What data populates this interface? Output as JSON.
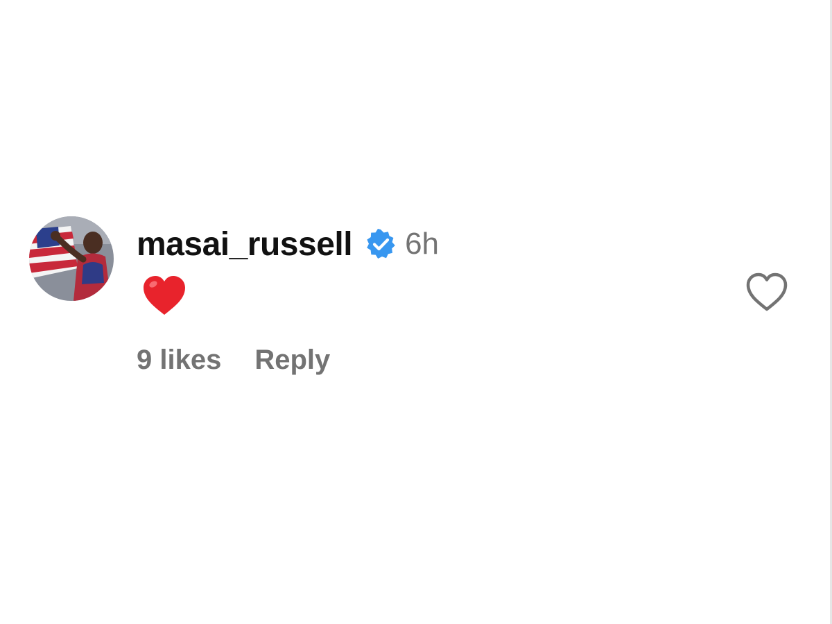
{
  "comment": {
    "username": "masai_russell",
    "verified": true,
    "timestamp": "6h",
    "body_emoji": "red-heart",
    "likes_label": "9 likes",
    "reply_label": "Reply",
    "avatar_icon": "profile-photo",
    "like_icon": "heart-outline-icon"
  },
  "colors": {
    "verified_blue": "#3897f0",
    "heart_red": "#e8232c",
    "secondary_text": "#737373",
    "primary_text": "#111111"
  }
}
